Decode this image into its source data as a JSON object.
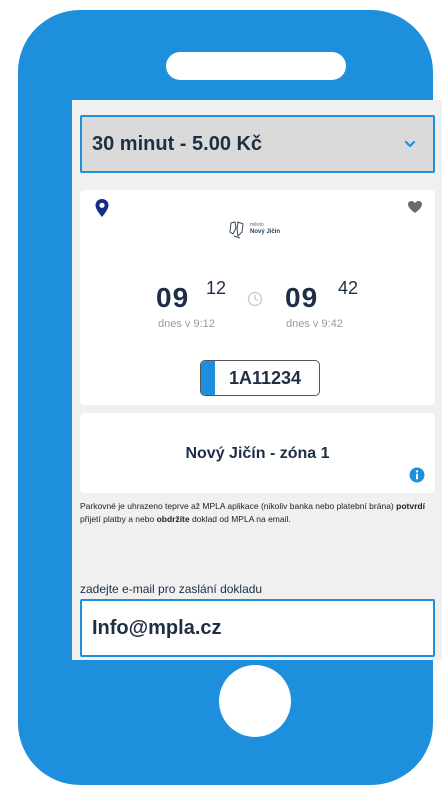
{
  "duration_select": {
    "selected": "30 minut - 5.00 Kč"
  },
  "parking_card": {
    "logo_small_text": "město",
    "logo_name": "Nový Jičín",
    "start": {
      "hour": "09",
      "minute": "12",
      "label": "dnes v 9:12"
    },
    "end": {
      "hour": "09",
      "minute": "42",
      "label": "dnes v 9:42"
    },
    "license_plate": "1A11234"
  },
  "zone": {
    "name": "Nový Jičín - zóna 1"
  },
  "notice": {
    "part1": "Parkovné je uhrazeno teprve až MPLA aplikace (nikoliv banka nebo platební brána) ",
    "bold1": "potvrdí",
    "part2": " přijetí platby a nebo ",
    "bold2": "obdržíte",
    "part3": " doklad od MPLA na email."
  },
  "email": {
    "label": "zadejte e-mail pro zaslání dokladu",
    "value": "Info@mpla.cz"
  },
  "colors": {
    "phone": "#1e8fdc",
    "accent": "#1e8fdc",
    "text_dark": "#1e2f45",
    "location_pin": "#1a2a8a"
  }
}
